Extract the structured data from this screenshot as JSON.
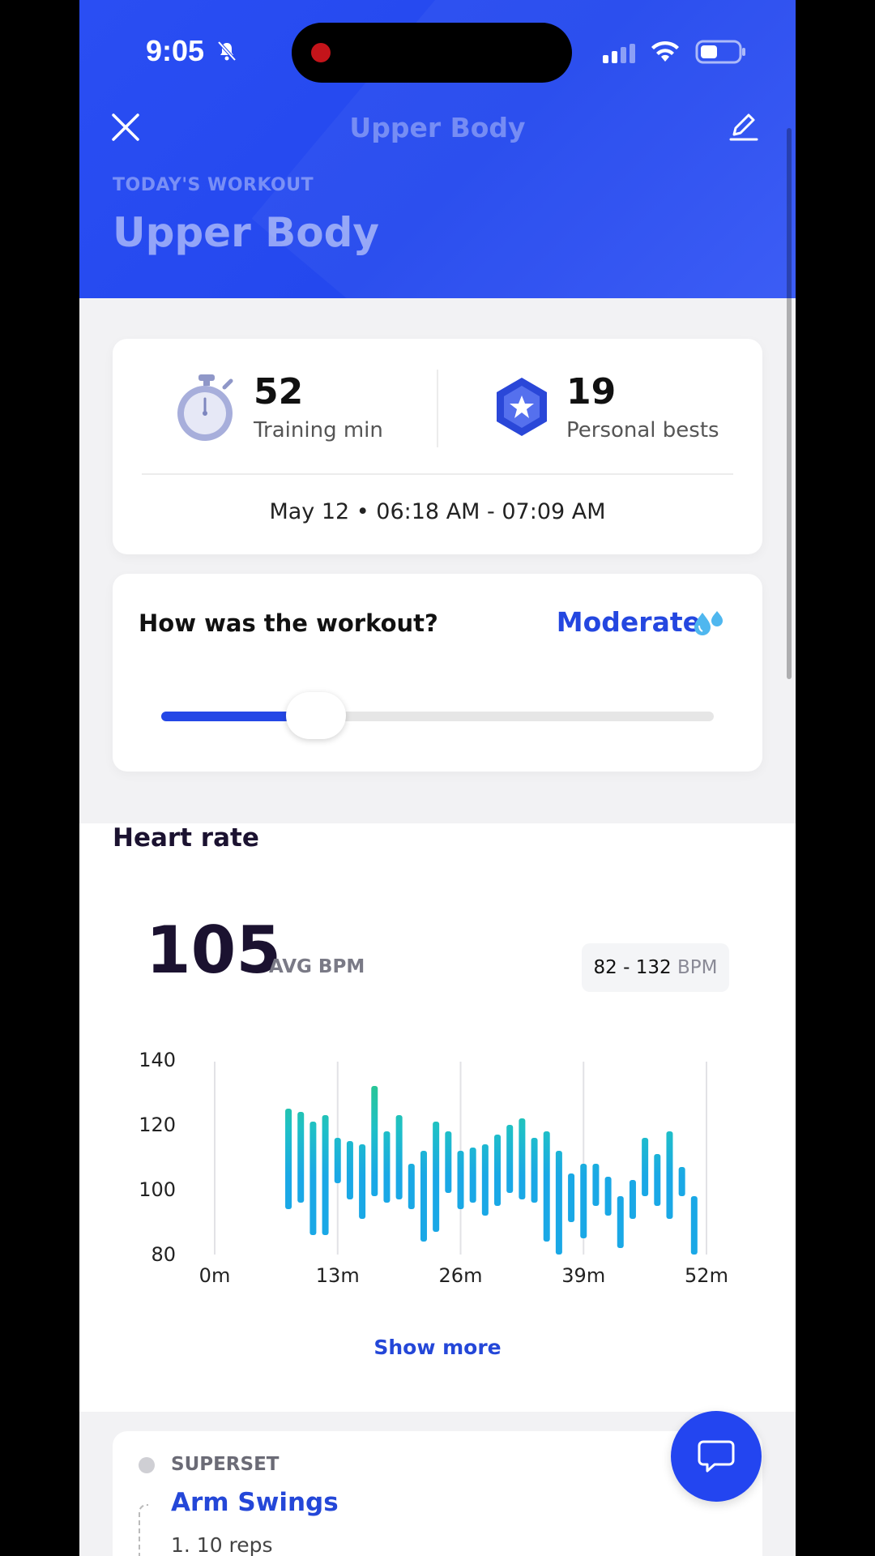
{
  "status_bar": {
    "time": "9:05"
  },
  "header": {
    "nav_title": "Upper Body",
    "eyebrow": "TODAY'S WORKOUT",
    "title": "Upper Body",
    "close_icon": "close-icon",
    "edit_icon": "pencil-icon"
  },
  "stats": {
    "training_value": "52",
    "training_label": "Training min",
    "bests_value": "19",
    "bests_label": "Personal bests",
    "date_line": "May 12 • 06:18 AM - 07:09 AM"
  },
  "rating": {
    "question": "How was the workout?",
    "value": "Moderate",
    "level": 0.28
  },
  "heart_rate": {
    "title": "Heart rate",
    "avg": "105",
    "avg_label": "AVG BPM",
    "range": "82 - 132",
    "range_unit": "BPM",
    "show_more": "Show more"
  },
  "exercise": {
    "tag": "SUPERSET",
    "name": "Arm Swings",
    "reps": "1. 10 reps"
  },
  "colors": {
    "accent": "#2447e6",
    "header": "#2a4ef3",
    "bar_low": "#1aa8e6",
    "bar_high": "#2ec97a"
  },
  "chart_data": {
    "type": "bar",
    "ylim": [
      80,
      140
    ],
    "yticks": [
      80,
      100,
      120,
      140
    ],
    "xlim": [
      0,
      52
    ],
    "xticks": [
      "0m",
      "13m",
      "26m",
      "39m",
      "52m"
    ],
    "bars": [
      {
        "t": 7.8,
        "lo": 94,
        "hi": 125
      },
      {
        "t": 9.1,
        "lo": 96,
        "hi": 124
      },
      {
        "t": 10.4,
        "lo": 86,
        "hi": 121
      },
      {
        "t": 11.7,
        "lo": 86,
        "hi": 123
      },
      {
        "t": 13.0,
        "lo": 102,
        "hi": 116
      },
      {
        "t": 14.3,
        "lo": 97,
        "hi": 115
      },
      {
        "t": 15.6,
        "lo": 91,
        "hi": 114
      },
      {
        "t": 16.9,
        "lo": 98,
        "hi": 132
      },
      {
        "t": 18.2,
        "lo": 96,
        "hi": 118
      },
      {
        "t": 19.5,
        "lo": 97,
        "hi": 123
      },
      {
        "t": 20.8,
        "lo": 94,
        "hi": 108
      },
      {
        "t": 22.1,
        "lo": 84,
        "hi": 112
      },
      {
        "t": 23.4,
        "lo": 87,
        "hi": 121
      },
      {
        "t": 24.7,
        "lo": 99,
        "hi": 118
      },
      {
        "t": 26.0,
        "lo": 94,
        "hi": 112
      },
      {
        "t": 27.3,
        "lo": 96,
        "hi": 113
      },
      {
        "t": 28.6,
        "lo": 92,
        "hi": 114
      },
      {
        "t": 29.9,
        "lo": 95,
        "hi": 117
      },
      {
        "t": 31.2,
        "lo": 99,
        "hi": 120
      },
      {
        "t": 32.5,
        "lo": 97,
        "hi": 122
      },
      {
        "t": 33.8,
        "lo": 96,
        "hi": 116
      },
      {
        "t": 35.1,
        "lo": 84,
        "hi": 118
      },
      {
        "t": 36.4,
        "lo": 80,
        "hi": 112
      },
      {
        "t": 37.7,
        "lo": 90,
        "hi": 105
      },
      {
        "t": 39.0,
        "lo": 85,
        "hi": 108
      },
      {
        "t": 40.3,
        "lo": 95,
        "hi": 108
      },
      {
        "t": 41.6,
        "lo": 92,
        "hi": 104
      },
      {
        "t": 42.9,
        "lo": 82,
        "hi": 98
      },
      {
        "t": 44.2,
        "lo": 91,
        "hi": 103
      },
      {
        "t": 45.5,
        "lo": 98,
        "hi": 116
      },
      {
        "t": 46.8,
        "lo": 95,
        "hi": 111
      },
      {
        "t": 48.1,
        "lo": 91,
        "hi": 118
      },
      {
        "t": 49.4,
        "lo": 98,
        "hi": 107
      },
      {
        "t": 50.7,
        "lo": 80,
        "hi": 98
      }
    ]
  }
}
